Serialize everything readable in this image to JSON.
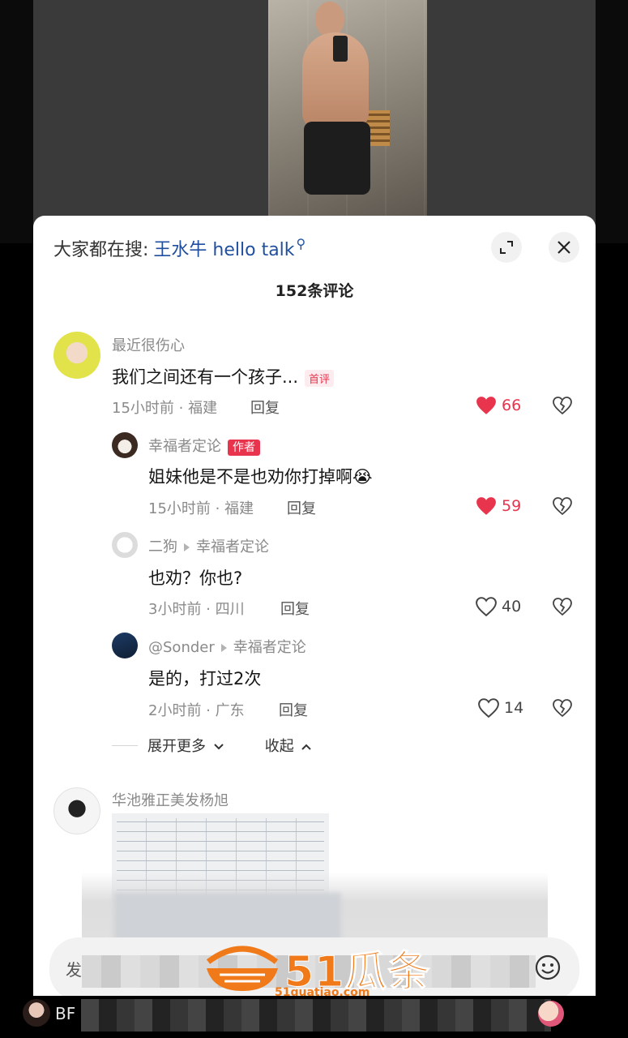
{
  "search": {
    "prefix": "大家都在搜:",
    "term": "王水牛 hello talk"
  },
  "sheet": {
    "count_title": "152条评论"
  },
  "comments": [
    {
      "username": "最近很伤心",
      "text": "我们之间还有一个孩子...",
      "tag": "首评",
      "meta": "15小时前 · 福建",
      "reply": "回复",
      "likes": "66",
      "liked": true
    },
    {
      "username": "幸福者定论",
      "tag": "作者",
      "text": "姐妹他是不是也劝你打掉啊😭",
      "meta": "15小时前 · 福建",
      "reply": "回复",
      "likes": "59",
      "liked": true
    },
    {
      "username": "二狗",
      "reply_to": "幸福者定论",
      "text": "也劝？你也?",
      "meta": "3小时前 · 四川",
      "reply": "回复",
      "likes": "40",
      "liked": false
    },
    {
      "username": "@Sonder",
      "reply_to": "幸福者定论",
      "text": "是的，打过2次",
      "meta": "2小时前 · 广东",
      "reply": "回复",
      "likes": "14",
      "liked": false
    }
  ],
  "thread_controls": {
    "expand_more": "展开更多",
    "collapse": "收起"
  },
  "next_comment": {
    "username": "华池雅正美发杨旭"
  },
  "input": {
    "placeholder": "发"
  },
  "watermark": {
    "brand": "51瓜条",
    "url": "51guatiao.com"
  },
  "bottom": {
    "name": "BF"
  },
  "colors": {
    "accent_red": "#e8344d",
    "search_blue": "#1f4f9e",
    "watermark_orange": "#f07a1a"
  },
  "icons": [
    "expand-icon",
    "close-icon",
    "heart-icon",
    "broken-heart-icon",
    "chevron-down-icon",
    "chevron-up-icon",
    "emoji-icon",
    "search-icon"
  ]
}
